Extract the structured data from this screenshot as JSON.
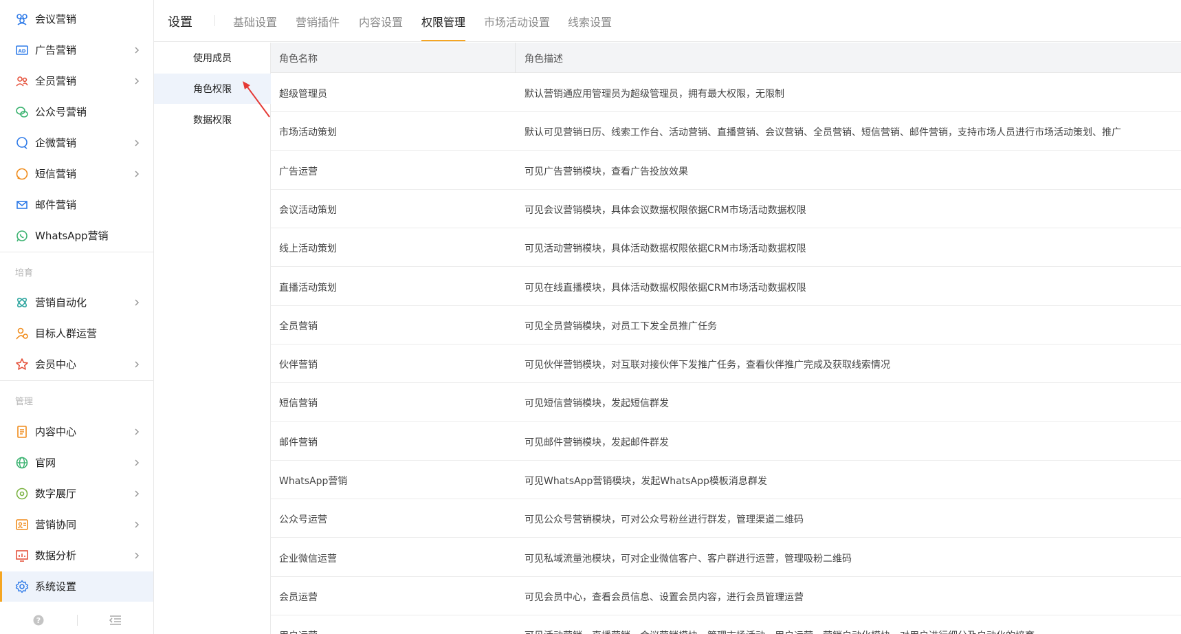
{
  "sidebar": {
    "items": [
      {
        "label": "会议营销",
        "icon": "people-group-icon",
        "has_arrow": false
      },
      {
        "label": "广告营销",
        "icon": "ad-icon",
        "has_arrow": true
      },
      {
        "label": "全员营销",
        "icon": "team-icon",
        "has_arrow": true
      },
      {
        "label": "公众号营销",
        "icon": "wechat-icon",
        "has_arrow": false
      },
      {
        "label": "企微营销",
        "icon": "chat-bubble-icon",
        "has_arrow": true
      },
      {
        "label": "短信营销",
        "icon": "message-icon",
        "has_arrow": true
      },
      {
        "label": "邮件营销",
        "icon": "mail-icon",
        "has_arrow": false
      },
      {
        "label": "WhatsApp营销",
        "icon": "whatsapp-icon",
        "has_arrow": false
      },
      {
        "label": "营销自动化",
        "icon": "automation-icon",
        "has_arrow": true
      },
      {
        "label": "目标人群运营",
        "icon": "target-people-icon",
        "has_arrow": false
      },
      {
        "label": "会员中心",
        "icon": "member-icon",
        "has_arrow": true
      },
      {
        "label": "内容中心",
        "icon": "document-icon",
        "has_arrow": true
      },
      {
        "label": "官网",
        "icon": "globe-icon",
        "has_arrow": true
      },
      {
        "label": "数字展厅",
        "icon": "planet-icon",
        "has_arrow": true
      },
      {
        "label": "营销协同",
        "icon": "collaboration-icon",
        "has_arrow": true
      },
      {
        "label": "数据分析",
        "icon": "analytics-icon",
        "has_arrow": true
      },
      {
        "label": "系统设置",
        "icon": "gear-icon",
        "has_arrow": false
      }
    ],
    "groups": [
      "培育",
      "管理"
    ],
    "footer": {
      "help_icon": "help-icon",
      "collapse_icon": "collapse-menu-icon"
    }
  },
  "header": {
    "title": "设置",
    "tabs": [
      "基础设置",
      "营销插件",
      "内容设置",
      "权限管理",
      "市场活动设置",
      "线索设置"
    ],
    "active_tab": "权限管理"
  },
  "subnav": {
    "items": [
      "使用成员",
      "角色权限",
      "数据权限"
    ],
    "active": "角色权限"
  },
  "table": {
    "columns": [
      "角色名称",
      "角色描述"
    ],
    "rows": [
      {
        "name": "超级管理员",
        "desc": "默认营销通应用管理员为超级管理员，拥有最大权限，无限制"
      },
      {
        "name": "市场活动策划",
        "desc": "默认可见营销日历、线索工作台、活动营销、直播营销、会议营销、全员营销、短信营销、邮件营销，支持市场人员进行市场活动策划、推广"
      },
      {
        "name": "广告运营",
        "desc": "可见广告营销模块，查看广告投放效果"
      },
      {
        "name": "会议活动策划",
        "desc": "可见会议营销模块，具体会议数据权限依据CRM市场活动数据权限"
      },
      {
        "name": "线上活动策划",
        "desc": "可见活动营销模块，具体活动数据权限依据CRM市场活动数据权限"
      },
      {
        "name": "直播活动策划",
        "desc": "可见在线直播模块，具体活动数据权限依据CRM市场活动数据权限"
      },
      {
        "name": "全员营销",
        "desc": "可见全员营销模块，对员工下发全员推广任务"
      },
      {
        "name": "伙伴营销",
        "desc": "可见伙伴营销模块，对互联对接伙伴下发推广任务，查看伙伴推广完成及获取线索情况"
      },
      {
        "name": "短信营销",
        "desc": "可见短信营销模块，发起短信群发"
      },
      {
        "name": "邮件营销",
        "desc": "可见邮件营销模块，发起邮件群发"
      },
      {
        "name": "WhatsApp营销",
        "desc": "可见WhatsApp营销模块，发起WhatsApp模板消息群发"
      },
      {
        "name": "公众号运营",
        "desc": "可见公众号营销模块，可对公众号粉丝进行群发，管理渠道二维码"
      },
      {
        "name": "企业微信运营",
        "desc": "可见私域流量池模块，可对企业微信客户、客户群进行运营，管理吸粉二维码"
      },
      {
        "name": "会员运营",
        "desc": "可见会员中心，查看会员信息、设置会员内容，进行会员管理运营"
      },
      {
        "name": "用户运营",
        "desc": "可见活动营销、直播营销、会议营销模块，管理市场活动，用户运营，营销自动化模块，对用户进行细分及自动化的培育"
      }
    ]
  },
  "colors": {
    "accent": "#f5a623",
    "active_bg": "#eef3fb",
    "arrow": "#e53935"
  }
}
